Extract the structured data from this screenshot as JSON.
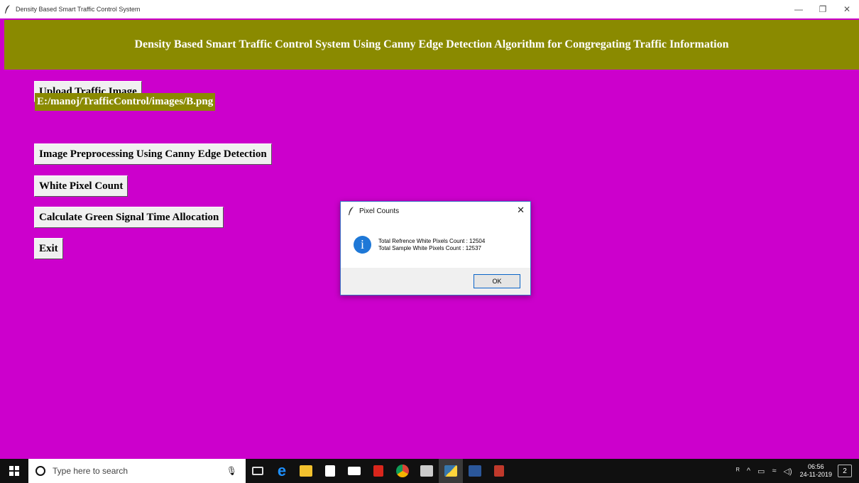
{
  "window": {
    "title": "Density Based Smart Traffic Control System",
    "minimize": "—",
    "restore": "❐",
    "close": "✕"
  },
  "app": {
    "heading": "Density Based Smart Traffic Control System Using Canny Edge Detection Algorithm for Congregating Traffic Information",
    "upload_button": "Upload Traffic Image",
    "path_label": "E:/manoj/TrafficControl/images/B.png",
    "preprocess_button": "Image Preprocessing Using Canny Edge Detection",
    "pixel_count_button": "White Pixel Count",
    "green_signal_button": "Calculate Green Signal Time Allocation",
    "exit_button": "Exit"
  },
  "dialog": {
    "title": "Pixel Counts",
    "close": "✕",
    "icon_glyph": "i",
    "line1": "Total Refrence White Pixels Count : 12504",
    "line2": "Total Sample White Pixels Count : 12537",
    "ok": "OK"
  },
  "taskbar": {
    "search_placeholder": "Type here to search",
    "time": "06:56",
    "date": "24-11-2019",
    "notifications": "2"
  },
  "colors": {
    "background": "#cc00cc",
    "heading_bg": "#8a8a00",
    "dialog_accent": "#1e78d7"
  }
}
